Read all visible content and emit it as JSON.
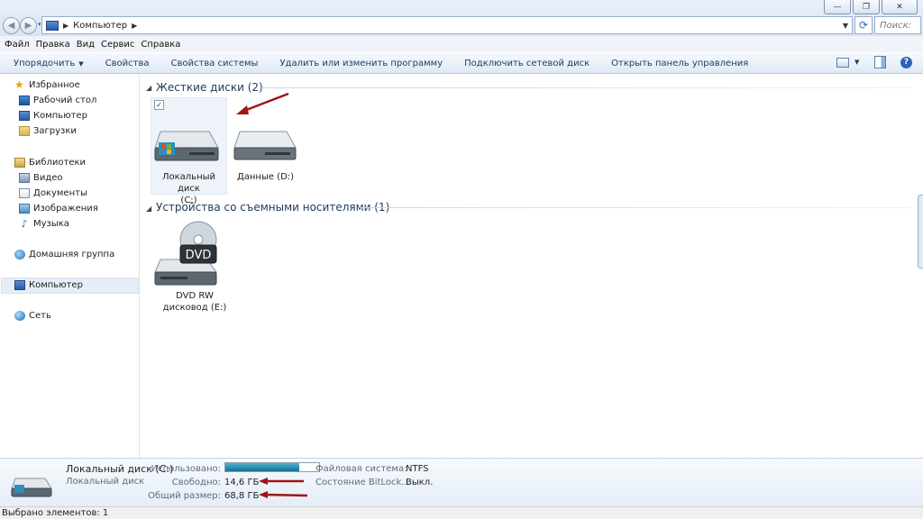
{
  "address": {
    "location": "Компьютер",
    "search_placeholder": "Поиск: "
  },
  "menu": [
    "Файл",
    "Правка",
    "Вид",
    "Сервис",
    "Справка"
  ],
  "toolbar": {
    "organize": "Упорядочить",
    "commands": [
      "Свойства",
      "Свойства системы",
      "Удалить или изменить программу",
      "Подключить сетевой диск",
      "Открыть панель управления"
    ]
  },
  "sidebar": {
    "favorites": {
      "label": "Избранное",
      "items": [
        "Рабочий стол",
        "Компьютер",
        "Загрузки"
      ]
    },
    "libraries": {
      "label": "Библиотеки",
      "items": [
        "Видео",
        "Документы",
        "Изображения",
        "Музыка"
      ]
    },
    "homegroup": "Домашняя группа",
    "computer": "Компьютер",
    "network": "Сеть"
  },
  "groups": {
    "hard_disks": {
      "header": "Жесткие диски (2)",
      "items": [
        {
          "label_line1": "Локальный диск",
          "label_line2": "(C:)",
          "selected": true
        },
        {
          "label_line1": "Данные (D:)",
          "label_line2": "",
          "selected": false
        }
      ]
    },
    "removable": {
      "header": "Устройства со съемными носителями (1)",
      "items": [
        {
          "label_line1": "DVD RW",
          "label_line2": "дисковод (E:)",
          "badge": "DVD"
        }
      ]
    }
  },
  "details": {
    "name": "Локальный диск (C:)",
    "type": "Локальный диск",
    "used_label": "Использовано:",
    "used_fraction": 0.79,
    "free_label": "Свободно:",
    "free_value": "14,6 ГБ",
    "total_label": "Общий размер:",
    "total_value": "68,8 ГБ",
    "fs_label": "Файловая система:",
    "fs_value": "NTFS",
    "bitlocker_label": "Состояние BitLock...",
    "bitlocker_value": "Выкл."
  },
  "status": "Выбрано элементов: 1",
  "colors": {
    "annotation_arrow": "#a01515",
    "usage_bar": "#1f7fa0"
  }
}
